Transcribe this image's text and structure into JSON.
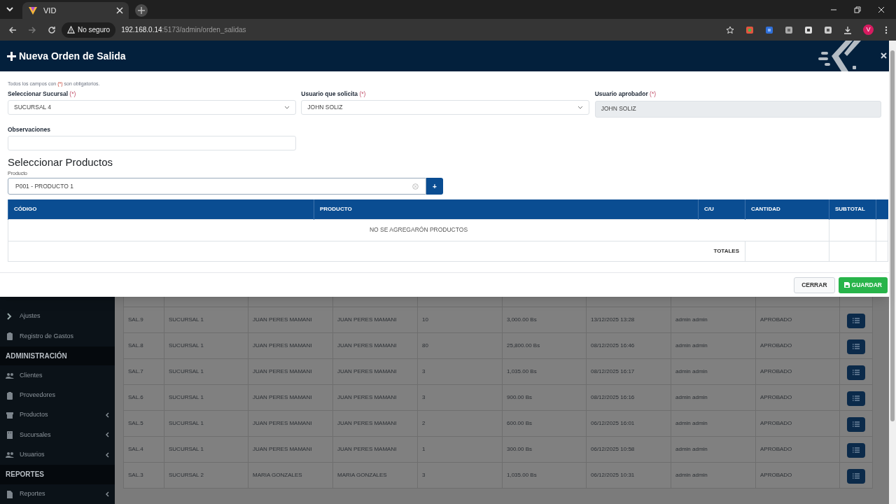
{
  "browser": {
    "tab_title": "VID",
    "security_label": "No seguro",
    "url_host": "192.168.0.14",
    "url_rest": ":5173/admin/orden_salidas",
    "profile_initial": "V"
  },
  "modal": {
    "title": "Nueva Orden de Salida",
    "required_note": {
      "before": "Todos los campos con",
      "mark": "(*)",
      "after": "son obligatorios."
    },
    "fields": [
      {
        "kind": "select",
        "label": "Seleccionar Sucursal",
        "required_mark": "(*)",
        "value": "SUCURSAL 4"
      },
      {
        "kind": "select",
        "label": "Usuario que solicita",
        "required_mark": "(*)",
        "value": "JOHN SOLIZ"
      },
      {
        "kind": "readonly",
        "label": "Usuario aprobador",
        "required_mark": "(*)",
        "value": "JOHN SOLIZ"
      }
    ],
    "observations": {
      "label": "Observaciones"
    },
    "section_title": "Seleccionar Productos",
    "product": {
      "label": "Producto",
      "value": "P001 - PRODUCTO 1",
      "add_label": "+"
    },
    "table": {
      "columns": [
        "CÓDIGO",
        "PRODUCTO",
        "C/U",
        "CANTIDAD",
        "SUBTOTAL"
      ],
      "empty_message": "NO SE AGREGARÓN PRODUCTOS",
      "totals_label": "TOTALES"
    },
    "buttons": [
      {
        "kind": "secondary",
        "label": "CERRAR"
      },
      {
        "kind": "primary",
        "label": "GUARDAR"
      }
    ]
  },
  "sidebar": {
    "items": [
      {
        "kind": "item",
        "label": "Ajustes",
        "submenu": false
      },
      {
        "kind": "item",
        "label": "Registro de Gastos",
        "submenu": false
      },
      {
        "kind": "header",
        "label": "ADMINISTRACIÓN"
      },
      {
        "kind": "item",
        "label": "Clientes",
        "submenu": false
      },
      {
        "kind": "item",
        "label": "Proveedores",
        "submenu": false
      },
      {
        "kind": "item",
        "label": "Productos",
        "submenu": true
      },
      {
        "kind": "item",
        "label": "Sucursales",
        "submenu": true
      },
      {
        "kind": "item",
        "label": "Usuarios",
        "submenu": true
      },
      {
        "kind": "header",
        "label": "REPORTES"
      },
      {
        "kind": "item",
        "label": "Reportes",
        "submenu": true
      }
    ]
  },
  "orders": {
    "rows": [
      [
        "SAL.9",
        "SUCURSAL 1",
        "JUAN PERES MAMANI",
        "JUAN PERES MAMANI",
        "10",
        "3,000.00 Bs",
        "13/12/2025 13:28",
        "admin admin",
        "APROBADO"
      ],
      [
        "SAL.8",
        "SUCURSAL 1",
        "JUAN PERES MAMANI",
        "JUAN PERES MAMANI",
        "80",
        "25,800.00 Bs",
        "08/12/2025 16:46",
        "admin admin",
        "APROBADO"
      ],
      [
        "SAL.7",
        "SUCURSAL 1",
        "JUAN PERES MAMANI",
        "JUAN PERES MAMANI",
        "3",
        "1,035.00 Bs",
        "08/12/2025 16:17",
        "admin admin",
        "APROBADO"
      ],
      [
        "SAL.6",
        "SUCURSAL 1",
        "JUAN PERES MAMANI",
        "JUAN PERES MAMANI",
        "3",
        "900.00 Bs",
        "08/12/2025 16:16",
        "admin admin",
        "APROBADO"
      ],
      [
        "SAL.5",
        "SUCURSAL 1",
        "JUAN PERES MAMANI",
        "JUAN PERES MAMANI",
        "2",
        "600.00 Bs",
        "06/12/2025 16:01",
        "admin admin",
        "APROBADO"
      ],
      [
        "SAL.4",
        "SUCURSAL 1",
        "JUAN PERES MAMANI",
        "JUAN PERES MAMANI",
        "1",
        "300.00 Bs",
        "06/12/2025 10:58",
        "admin admin",
        "APROBADO"
      ],
      [
        "SAL.3",
        "SUCURSAL 2",
        "MARIA GONZALES",
        "MARIA GONZALES",
        "3",
        "1,035.00 Bs",
        "06/12/2025 10:31",
        "admin admin",
        "APROBADO"
      ]
    ]
  }
}
